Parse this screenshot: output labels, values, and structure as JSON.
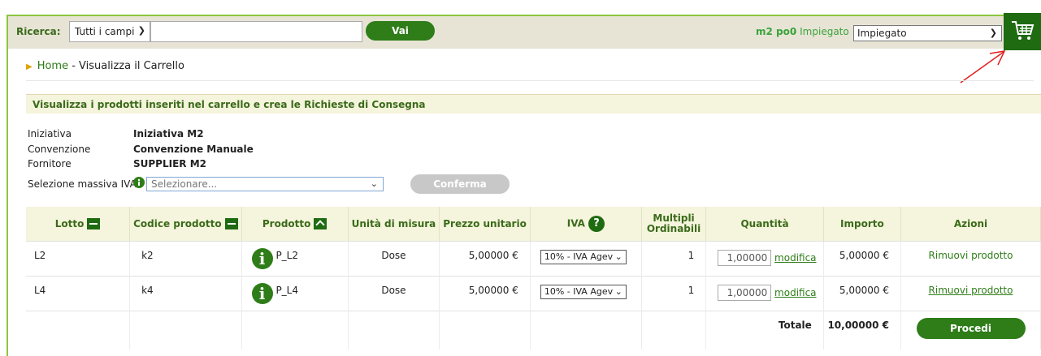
{
  "search": {
    "label": "Ricerca:",
    "field_value": "Tutti i campi",
    "query": "",
    "go_label": "Vai"
  },
  "user": {
    "name": "m2 po0",
    "role_prefix": "- Impiegato",
    "role_selected": "Impiegato"
  },
  "breadcrumb": {
    "home": "Home",
    "current": "- Visualizza il Carrello"
  },
  "section": {
    "title": "Visualizza i prodotti inseriti nel carrello e crea le Richieste di Consegna"
  },
  "info": {
    "iniziativa_label": "Iniziativa",
    "iniziativa_value": "Iniziativa M2",
    "convenzione_label": "Convenzione",
    "convenzione_value": "Convenzione Manuale",
    "fornitore_label": "Fornitore",
    "fornitore_value": "SUPPLIER M2"
  },
  "iva_mass": {
    "label": "Selezione massiva IVA",
    "placeholder": "Selezionare...",
    "confirm_label": "Conferma"
  },
  "table": {
    "headers": {
      "lotto": "Lotto",
      "codice": "Codice prodotto",
      "prodotto": "Prodotto",
      "unita": "Unità di misura",
      "prezzo": "Prezzo unitario",
      "iva": "IVA",
      "multipli_1": "Multipli",
      "multipli_2": "Ordinabili",
      "quantita": "Quantità",
      "importo": "Importo",
      "azioni": "Azioni"
    },
    "rows": [
      {
        "lotto": "L2",
        "codice": "k2",
        "prodotto": "P_L2",
        "unita": "Dose",
        "prezzo": "5,00000 €",
        "iva": "10% - IVA Agev",
        "multipli": "1",
        "quantita": "1,00000",
        "modifica": "modifica",
        "importo": "5,00000 €",
        "azione": "Rimuovi prodotto"
      },
      {
        "lotto": "L4",
        "codice": "k4",
        "prodotto": "P_L4",
        "unita": "Dose",
        "prezzo": "5,00000 €",
        "iva": "10% - IVA Agev",
        "multipli": "1",
        "quantita": "1,00000",
        "modifica": "modifica",
        "importo": "5,00000 €",
        "azione": "Rimuovi prodotto"
      }
    ],
    "totale_label": "Totale",
    "totale_value": "10,00000 €",
    "procedi_label": "Procedi"
  },
  "icons": {
    "cart": "cart-icon",
    "info": "info-icon",
    "help": "help-icon",
    "arrow": "red-arrow-annotation"
  },
  "colors": {
    "brand_green": "#2e7d18",
    "header_bg": "#e7e4d6",
    "section_bg": "#f5f4dc",
    "annotation": "#e02020"
  }
}
